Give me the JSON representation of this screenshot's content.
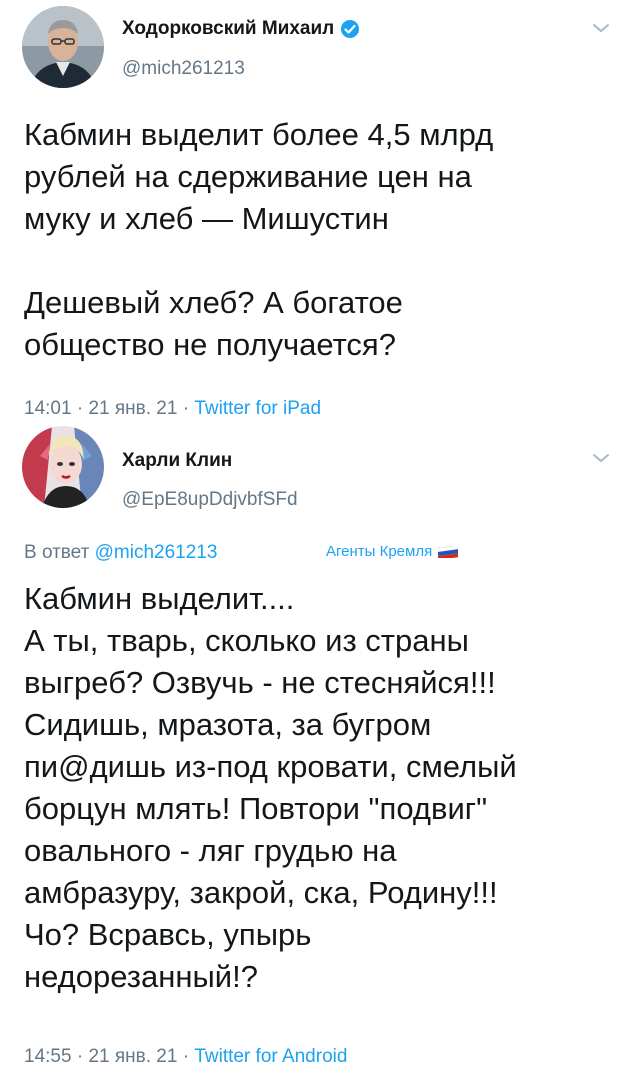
{
  "tweets": [
    {
      "author_name": "Ходорковский Михаил",
      "handle": "@mich261213",
      "verified": true,
      "text": "Кабмин выделит более 4,5 млрд\nрублей на сдерживание цен на\nмуку и хлеб — Мишустин\n\nДешевый хлеб? А богатое\nобщество не получается?",
      "time": "14:01",
      "date": "21 янв. 21",
      "source": "Twitter for iPad"
    },
    {
      "author_name": "Харли Клин",
      "handle": "@EpE8upDdjvbfSFd",
      "reply_prefix": "В ответ",
      "reply_to": "@mich261213",
      "watermark": "Агенты Кремля",
      "text": "Кабмин выделит....\nА ты, тварь, сколько из страны\nвыгреб? Озвучь - не стесняйся!!!\nСидишь, мразота, за бугром\nпи@дишь из-под кровати, смелый\nборцун млять! Повтори \"подвиг\"\nовального - ляг грудью на\nамбразуру, закрой, ска, Родину!!!\nЧо? Всравсь, упырь\nнедорезанный!?",
      "time": "14:55",
      "date": "21 янв. 21",
      "source": "Twitter for Android"
    }
  ],
  "separator": " · ",
  "icons": {
    "verified": "verified-badge-icon",
    "more": "chevron-down-icon",
    "flag": "russian-flag-icon"
  },
  "colors": {
    "text": "#14171a",
    "secondary": "#657786",
    "link": "#1da1f2",
    "background": "#ffffff"
  }
}
